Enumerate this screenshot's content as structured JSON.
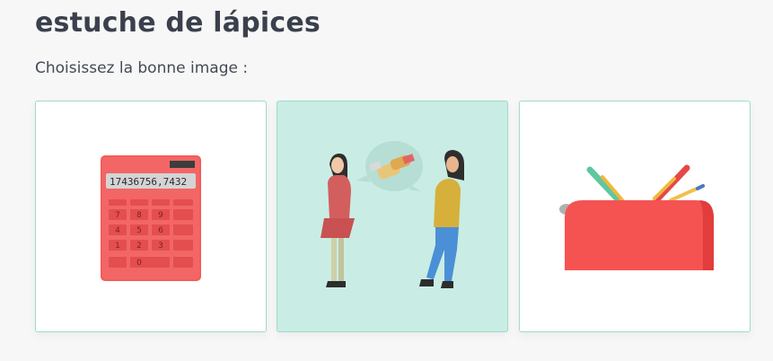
{
  "header": {
    "title": "estuche de lápices"
  },
  "instruction": "Choisissez la bonne image :",
  "options": [
    {
      "id": "calculator",
      "icon": "calculator-icon",
      "display": "17436756,7432",
      "keys": [
        "7",
        "8",
        "9",
        "4",
        "5",
        "6",
        "1",
        "2",
        "3",
        "0"
      ],
      "selected": false
    },
    {
      "id": "handshake-conversation",
      "icon": "handshake-conversation-icon",
      "selected": true
    },
    {
      "id": "pencil-case",
      "icon": "pencil-case-icon",
      "selected": false
    }
  ],
  "colors": {
    "accent_border": "#9fdcc6",
    "selected_bg": "#c9ede4",
    "calculator_red": "#f45b5b",
    "pencil_case_red": "#f45352"
  }
}
